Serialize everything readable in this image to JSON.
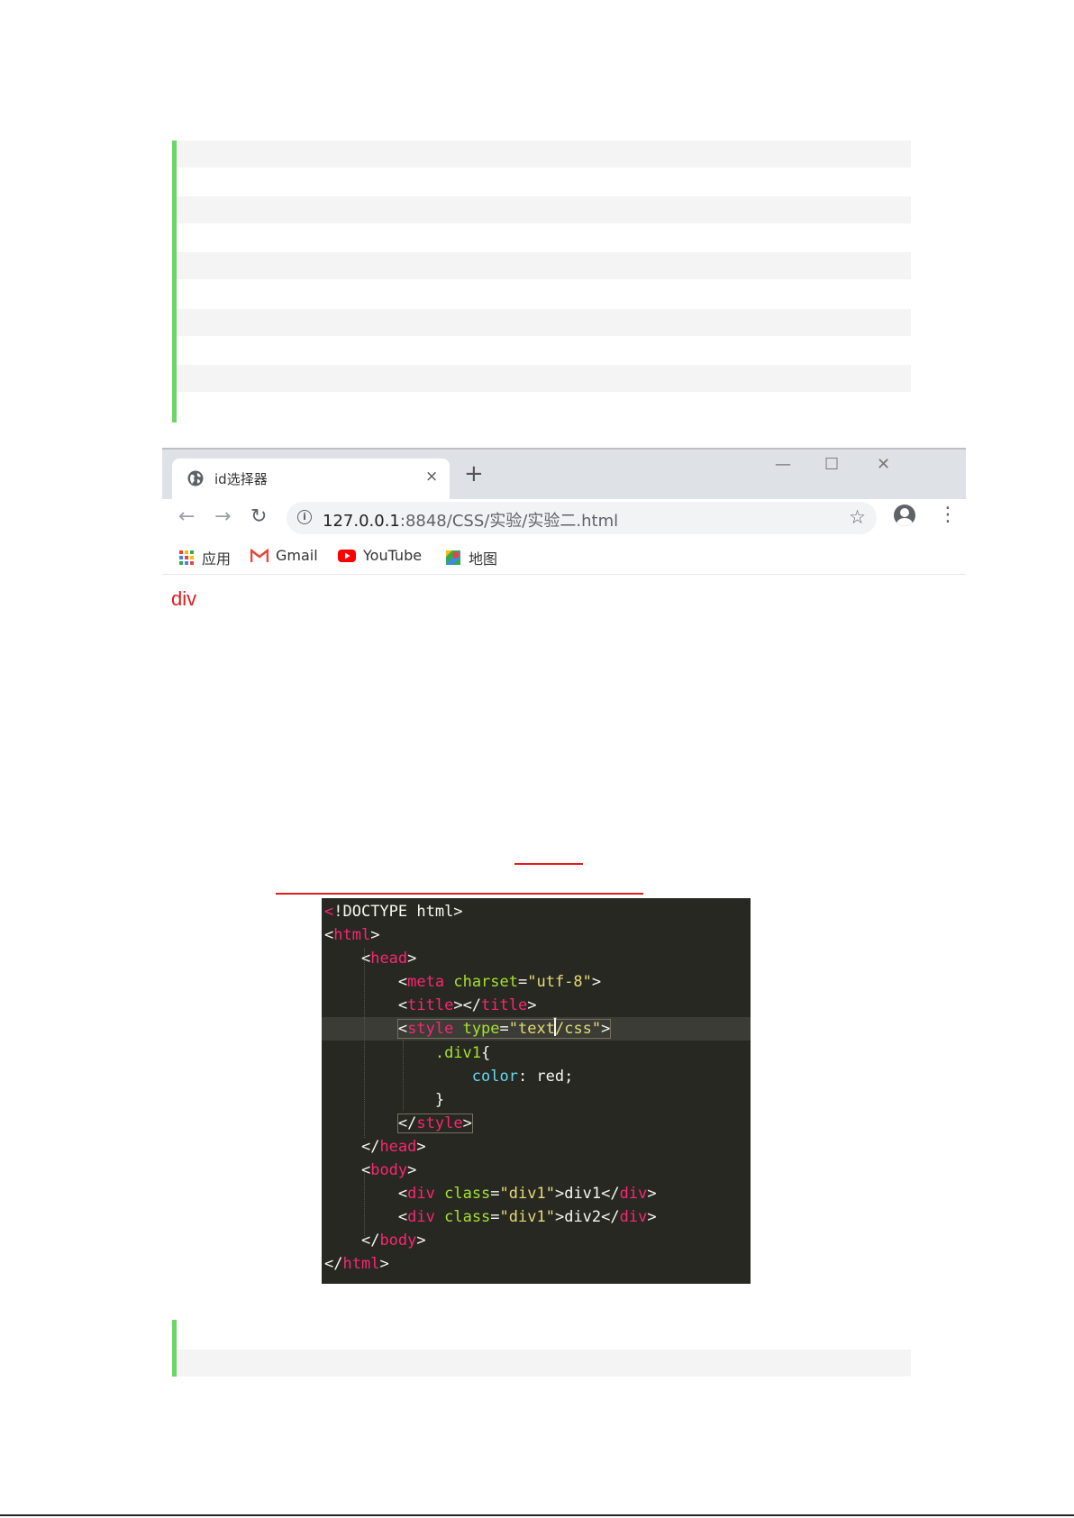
{
  "browser": {
    "tab_title": "id选择器",
    "tab_close": "×",
    "new_tab": "+",
    "window_controls": {
      "minimize": "—",
      "maximize": "☐",
      "close": "✕"
    },
    "nav": {
      "back": "←",
      "forward": "→",
      "reload": "↻"
    },
    "url_host": "127.0.0.1",
    "url_rest": ":8848/CSS/实验/实验二.html",
    "bookmarks": [
      {
        "label": "应用",
        "icon": "apps-grid-icon"
      },
      {
        "label": "Gmail",
        "icon": "gmail-icon"
      },
      {
        "label": "YouTube",
        "icon": "youtube-icon"
      },
      {
        "label": "地图",
        "icon": "maps-icon"
      }
    ],
    "page_output": "div"
  },
  "code": {
    "lines": [
      "<!DOCTYPE html>",
      "<html>",
      "<head>",
      "<meta charset=\"utf-8\">",
      "<title></title>",
      "<style type=\"text/css\">",
      ".div1{",
      "color: red;",
      "}",
      "</style>",
      "</head>",
      "<body>",
      "<div class=\"div1\">div1</div>",
      "<div class=\"div1\">div2</div>",
      "</body>",
      "</html>"
    ]
  },
  "colors": {
    "quote_bar": "#6fd46a",
    "stripe": "#f4f4f4",
    "red_text": "#e01b1b",
    "editor_bg": "#272822",
    "tag": "#f92672",
    "attr": "#a6e22e",
    "string": "#e6db74",
    "property": "#66d9ef"
  }
}
